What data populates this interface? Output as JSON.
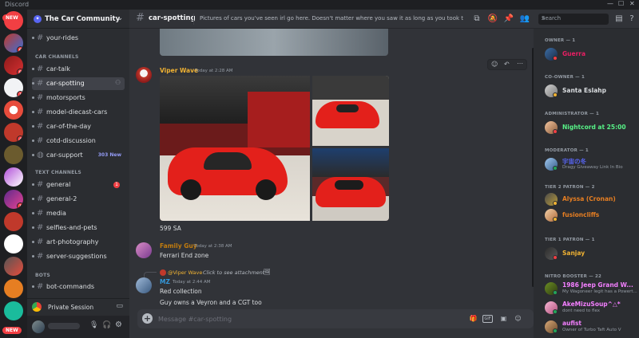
{
  "window": {
    "title": "Discord"
  },
  "guild": {
    "name": "The Car Community"
  },
  "servers": {
    "new_top": "NEW",
    "new_bottom": "NEW",
    "badges": [
      "6",
      "8",
      "1",
      "4",
      "1"
    ]
  },
  "categories": {
    "car_channels": "CAR CHANNELS",
    "text_channels": "TEXT CHANNELS",
    "bots": "BOTS"
  },
  "channels": [
    {
      "name": "your-rides"
    },
    {
      "name": "car-talk"
    },
    {
      "name": "car-spotting"
    },
    {
      "name": "motorsports"
    },
    {
      "name": "model-diecast-cars"
    },
    {
      "name": "car-of-the-day"
    },
    {
      "name": "cotd-discussion"
    },
    {
      "name": "car-support",
      "new": "303 New"
    },
    {
      "name": "general",
      "badge": "1"
    },
    {
      "name": "general-2"
    },
    {
      "name": "media"
    },
    {
      "name": "selfies-and-pets"
    },
    {
      "name": "art-photography"
    },
    {
      "name": "server-suggestions"
    },
    {
      "name": "bot-commands"
    }
  ],
  "private_session": "Private Session",
  "topbar": {
    "channel": "car-spotting",
    "topic": "Pictures of cars you've seen irl go here. Doesn't matter where you saw it as long as you took the picture. M...",
    "search_placeholder": "Search"
  },
  "messages": [
    {
      "author": "Viper Wave",
      "time": "Today at 2:28 AM",
      "caption": "599 SA",
      "color": "#f0b232"
    },
    {
      "author": "Family Guy",
      "time": "Today at 2:38 AM",
      "text": "Ferrari End zone",
      "color": "#c27c0e"
    },
    {
      "reply_author": "@Viper Wave",
      "reply_text": "Click to see attachment",
      "author": "MZ",
      "time": "Today at 2:44 AM",
      "text": "Red collection",
      "text2": "Guy owns a Veyron and a CGT too",
      "color": "#3498db"
    }
  ],
  "composer": {
    "placeholder": "Message #car-spotting",
    "gif": "GIF"
  },
  "members": {
    "roles": [
      {
        "header": "OWNER — 1",
        "members": [
          {
            "name": "Guerra",
            "color": "#e91e63"
          }
        ]
      },
      {
        "header": "CO-OWNER — 1",
        "members": [
          {
            "name": "Santa Eslahp",
            "color": "#dbdee1"
          }
        ]
      },
      {
        "header": "ADMINISTRATOR — 1",
        "members": [
          {
            "name": "Nightcord at 25:00",
            "color": "#57f287"
          }
        ]
      },
      {
        "header": "MODERATOR — 1",
        "members": [
          {
            "name": "宇宙の冬",
            "color": "#5865f2",
            "status": "Dragy Giveaway Link In Bio"
          }
        ]
      },
      {
        "header": "TIER 2 PATRON — 2",
        "members": [
          {
            "name": "Alyssa (Cronan)",
            "color": "#e67e22"
          },
          {
            "name": "fusioncliffs",
            "color": "#e67e22"
          }
        ]
      },
      {
        "header": "TIER 1 PATRON — 1",
        "members": [
          {
            "name": "Sanjay",
            "color": "#f0b232"
          }
        ]
      },
      {
        "header": "NITRO BOOSTER — 22",
        "members": [
          {
            "name": "1986 Jeep Grand W...",
            "color": "#f47fff",
            "status": "My Wagoneer legit has a Powert..."
          },
          {
            "name": "AkeMizuSoup^△*",
            "color": "#f47fff",
            "status": "dont need to flex"
          },
          {
            "name": "aufist",
            "color": "#f47fff",
            "status": "Owner of Turbo Taft Auto V"
          }
        ]
      }
    ]
  }
}
